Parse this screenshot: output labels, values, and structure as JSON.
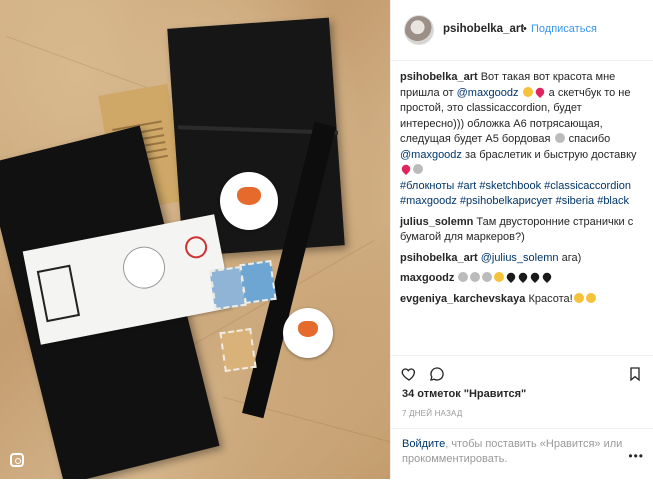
{
  "header": {
    "username": "psihobelka_art",
    "dot": "•",
    "follow_label": "Подписаться"
  },
  "caption": {
    "username": "psihobelka_art",
    "text_1": " Вот такая вот красота мне пришла от ",
    "mention": "@maxgoodz",
    "text_2": "  а скетчбук то не простой, это classicaccordion, будет интересно))) обложка А6 потрясающая, следущая будет А5 бордовая",
    "text_3": " спасибо ",
    "mention_2": "@maxgoodz",
    "text_4": " за браслетик и быструю доставку",
    "hashtags": "#блокноты #art #sketchbook #classicaccordion #maxgoodz #psihobelkaрисует #siberia #black"
  },
  "comments": [
    {
      "username": "julius_solemn",
      "text": " Там двусторонние странички с бумагой для маркеров?)"
    },
    {
      "username": "psihobelka_art",
      "mention": "@julius_solemn",
      "text": " ага)"
    },
    {
      "username": "maxgoodz",
      "text": ""
    },
    {
      "username": "evgeniya_karchevskaya",
      "text": " Красота!"
    }
  ],
  "likes": "34 отметок \"Нравится\"",
  "date": "7 ДНЕЙ НАЗАД",
  "footer": {
    "login_link": "Войдите",
    "text": ", чтобы поставить «Нравится» или прокомментировать.",
    "more_icon": "•••"
  },
  "icons": {
    "like": "heart-outline-icon",
    "comment": "speech-bubble-icon",
    "save": "bookmark-icon",
    "instagram": "instagram-camera-icon"
  },
  "colors": {
    "link_blue": "#3897f0",
    "dark_link": "#003569",
    "muted": "#999999"
  }
}
